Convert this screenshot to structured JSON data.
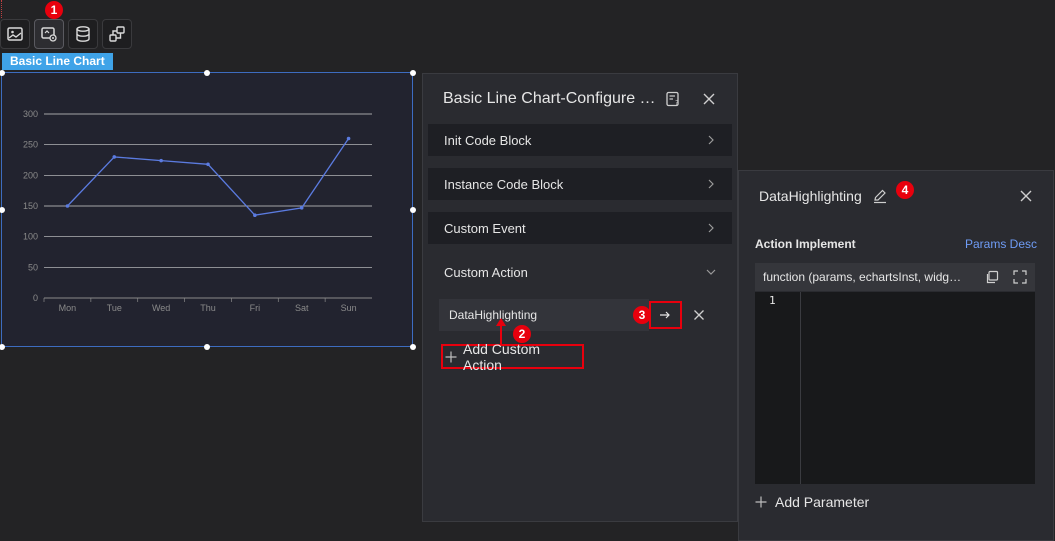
{
  "annotations": [
    "1",
    "2",
    "3",
    "4"
  ],
  "toolbar": {
    "icons": [
      "image-icon",
      "chart-settings-icon",
      "database-icon",
      "interaction-icon"
    ]
  },
  "widget": {
    "tag": "Basic Line Chart"
  },
  "chart_data": {
    "type": "line",
    "categories": [
      "Mon",
      "Tue",
      "Wed",
      "Thu",
      "Fri",
      "Sat",
      "Sun"
    ],
    "values": [
      150,
      230,
      224,
      218,
      135,
      147,
      260
    ],
    "yticks": [
      0,
      50,
      100,
      150,
      200,
      250,
      300
    ],
    "ylim": [
      0,
      300
    ],
    "title": "",
    "xlabel": "",
    "ylabel": "",
    "grid": true,
    "line_color": "#5b7be0"
  },
  "config_panel": {
    "title": "Basic Line Chart-Configure Dynamic Interaction",
    "sections": [
      {
        "label": "Init Code Block",
        "expanded": false
      },
      {
        "label": "Instance Code Block",
        "expanded": false
      },
      {
        "label": "Custom Event",
        "expanded": false
      },
      {
        "label": "Custom Action",
        "expanded": true
      }
    ],
    "action_item": "DataHighlighting",
    "add_action_label": "Add Custom Action"
  },
  "action_panel": {
    "title": "DataHighlighting",
    "implement_label": "Action Implement",
    "params_desc": "Params Desc",
    "code_signature": "function (params, echartsInst, widgetInst)",
    "line_number": "1",
    "add_param_label": "Add Parameter"
  },
  "colors": {
    "accent": "#3fa3e8",
    "highlight": "#e8000d",
    "link": "#6f9cf5"
  }
}
